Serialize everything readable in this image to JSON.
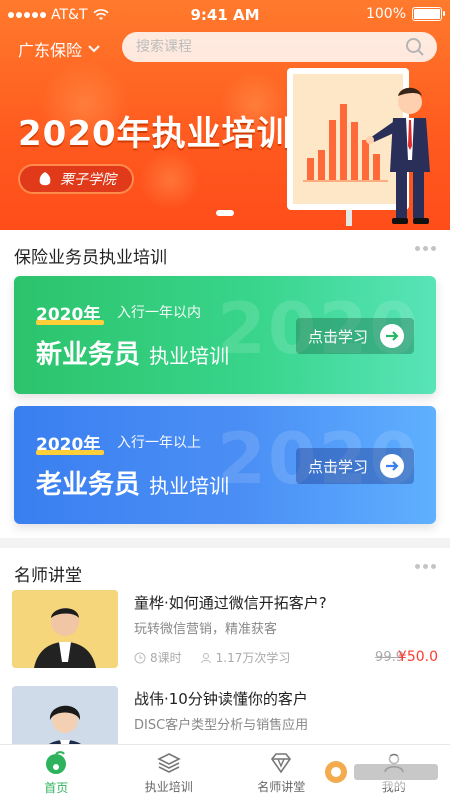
{
  "status_bar": {
    "carrier": "AT&T",
    "time": "9:41 AM",
    "battery": "100%"
  },
  "header": {
    "location": "广东保险",
    "search_placeholder": "搜索课程"
  },
  "banner": {
    "title": "2020年执业培训",
    "brand": "栗子学院"
  },
  "training_section": {
    "title": "保险业务员执业培训",
    "cards": [
      {
        "year": "2020年",
        "subtitle": "入行一年以内",
        "title_main": "新业务员",
        "title_sub": "执业培训",
        "button": "点击学习",
        "theme": "green"
      },
      {
        "year": "2020年",
        "subtitle": "入行一年以上",
        "title_main": "老业务员",
        "title_sub": "执业培训",
        "button": "点击学习",
        "theme": "blue"
      }
    ]
  },
  "lecture_section": {
    "title": "名师讲堂",
    "courses": [
      {
        "title": "童桦·如何通过微信开拓客户?",
        "desc": "玩转微信营销，精准获客",
        "lessons": "8课时",
        "learners": "1.17万次学习",
        "old_price": "99.9",
        "price": "¥50.0"
      },
      {
        "title": "战伟·10分钟读懂你的客户",
        "desc": "DISC客户类型分析与销售应用"
      }
    ]
  },
  "tabbar": {
    "items": [
      {
        "label": "首页",
        "icon": "home-icon",
        "active": true
      },
      {
        "label": "执业培训",
        "icon": "layers-icon"
      },
      {
        "label": "名师讲堂",
        "icon": "diamond-icon"
      },
      {
        "label": "我的",
        "icon": "user-icon"
      }
    ]
  },
  "colors": {
    "accent": "#2db35c",
    "banner": "#ff5a1f",
    "price": "#ff3b30"
  }
}
